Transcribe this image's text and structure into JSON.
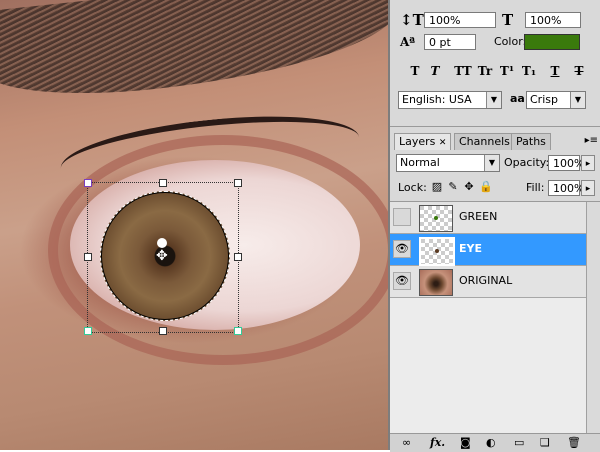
{
  "character_panel": {
    "vertical_scale": "100%",
    "horizontal_scale": "100%",
    "baseline_shift": "0 pt",
    "color_label": "Color:",
    "color_value": "#3a7a0c",
    "language": "English: USA",
    "anti_alias_label": "aa",
    "anti_alias": "Crisp",
    "style_buttons": [
      "T",
      "T",
      "TT",
      "Tr",
      "T¹",
      "T₁",
      "T",
      "T"
    ]
  },
  "layers_panel": {
    "tabs": [
      "Layers",
      "Channels",
      "Paths"
    ],
    "active_tab": "Layers",
    "blend_mode": "Normal",
    "opacity_label": "Opacity:",
    "opacity": "100%",
    "lock_label": "Lock:",
    "fill_label": "Fill:",
    "fill": "100%",
    "layers": [
      {
        "name": "GREEN",
        "visible": false,
        "selected": false
      },
      {
        "name": "EYE",
        "visible": true,
        "selected": true
      },
      {
        "name": "ORIGINAL",
        "visible": true,
        "selected": false
      }
    ],
    "bottom_icons": [
      "link-icon",
      "fx-icon",
      "mask-icon",
      "adjustment-icon",
      "group-icon",
      "new-layer-icon",
      "trash-icon"
    ],
    "fx_label": "fx."
  },
  "icons": {
    "eye": "👁",
    "close": "✕",
    "drop": "▼",
    "panel_menu": "▸≡",
    "crosshair": "✥"
  }
}
